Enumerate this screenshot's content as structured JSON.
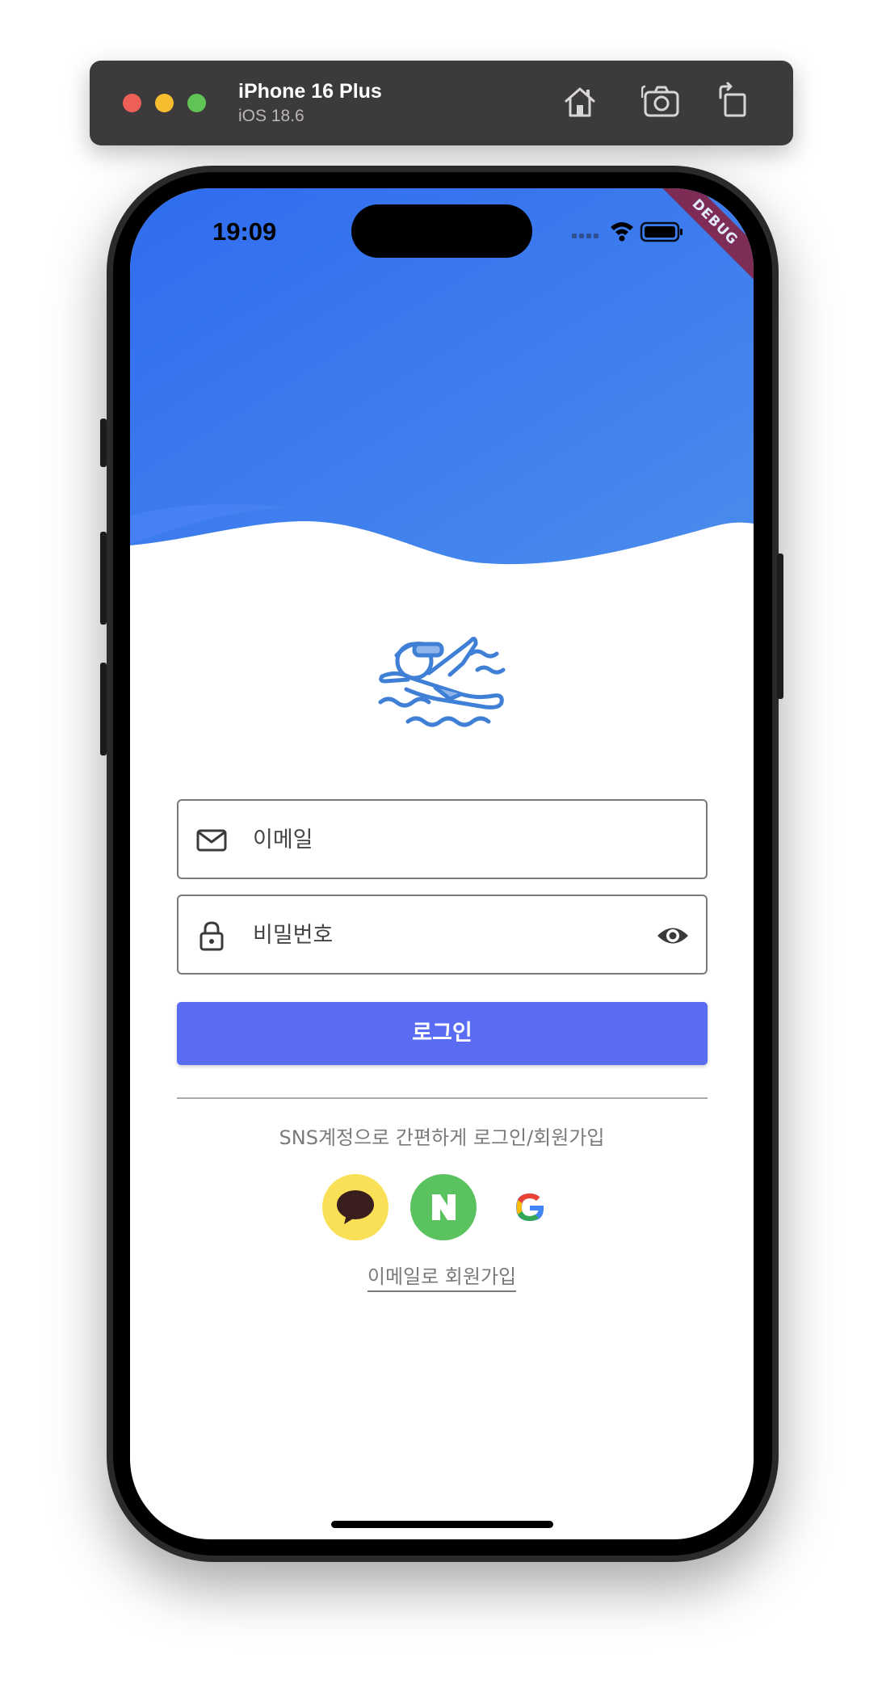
{
  "simulator": {
    "device_name": "iPhone 16 Plus",
    "os_version": "iOS 18.6",
    "toolbar_icons": [
      "home-icon",
      "screenshot-icon",
      "rotate-icon"
    ]
  },
  "status_bar": {
    "time": "19:09",
    "icons": [
      "cellular-icon",
      "wifi-icon",
      "battery-icon"
    ]
  },
  "debug_banner": "DEBUG",
  "header": {
    "gradient": [
      "#2f6cf0",
      "#4a8cec"
    ]
  },
  "logo": {
    "icon": "swimmer-icon",
    "color": "#3f80d6"
  },
  "form": {
    "email": {
      "placeholder": "이메일",
      "value": "",
      "icon": "mail-icon"
    },
    "password": {
      "placeholder": "비밀번호",
      "value": "",
      "icon": "lock-icon",
      "toggle_icon": "eye-icon"
    },
    "login_label": "로그인"
  },
  "sns": {
    "caption": "SNS계정으로 간편하게 로그인/회원가입",
    "providers": [
      {
        "name": "kakao",
        "icon": "kakao-talk-icon",
        "color": "#fae057"
      },
      {
        "name": "naver",
        "icon": "naver-icon",
        "color": "#5ac35f"
      },
      {
        "name": "google",
        "icon": "google-icon",
        "color": "#ffffff"
      }
    ]
  },
  "signup_link": "이메일로 회원가입",
  "colors": {
    "accent": "#596cf3",
    "header_top": "#2f6cf0",
    "header_bottom": "#4a8cec"
  }
}
